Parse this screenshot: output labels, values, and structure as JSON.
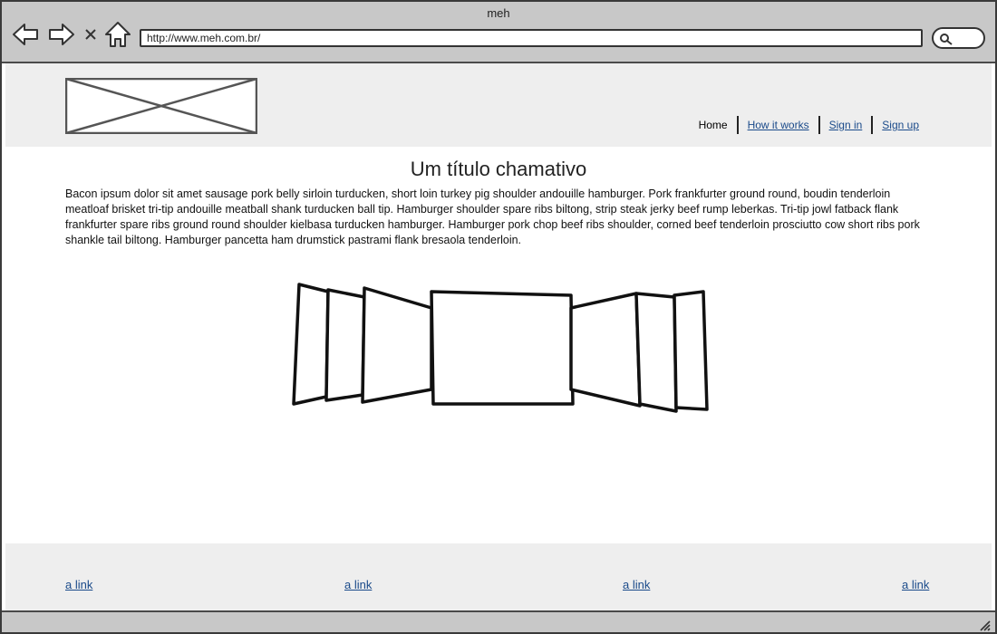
{
  "window": {
    "title": "meh"
  },
  "toolbar": {
    "back_icon": "back-arrow-icon",
    "forward_icon": "forward-arrow-icon",
    "stop_icon": "close-icon",
    "home_icon": "home-icon",
    "search_icon": "search-icon"
  },
  "address_bar": {
    "url": "http://www.meh.com.br/"
  },
  "header": {
    "logo": "image-placeholder",
    "nav": [
      "Home",
      "How it works",
      "Sign in",
      "Sign up"
    ],
    "active_item": "Home"
  },
  "main": {
    "title": "Um título chamativo",
    "body": "Bacon ipsum dolor sit amet sausage pork belly sirloin turducken, short loin turkey pig shoulder andouille hamburger. Pork frankfurter ground round, boudin tenderloin meatloaf brisket tri-tip andouille meatball shank turducken ball tip. Hamburger shoulder spare ribs biltong, strip steak jerky beef rump leberkas. Tri-tip jowl fatback flank frankfurter spare ribs ground round shoulder kielbasa turducken hamburger. Hamburger pork chop beef ribs shoulder, corned beef tenderloin prosciutto cow short ribs pork shankle tail biltong. Hamburger pancetta ham drumstick pastrami flank bresaola tenderloin."
  },
  "footer": {
    "links": [
      "a link",
      "a link",
      "a link",
      "a link"
    ]
  },
  "colors": {
    "chrome": "#c8c8c8",
    "band": "#eeeeee",
    "link": "#1a4a8a"
  }
}
